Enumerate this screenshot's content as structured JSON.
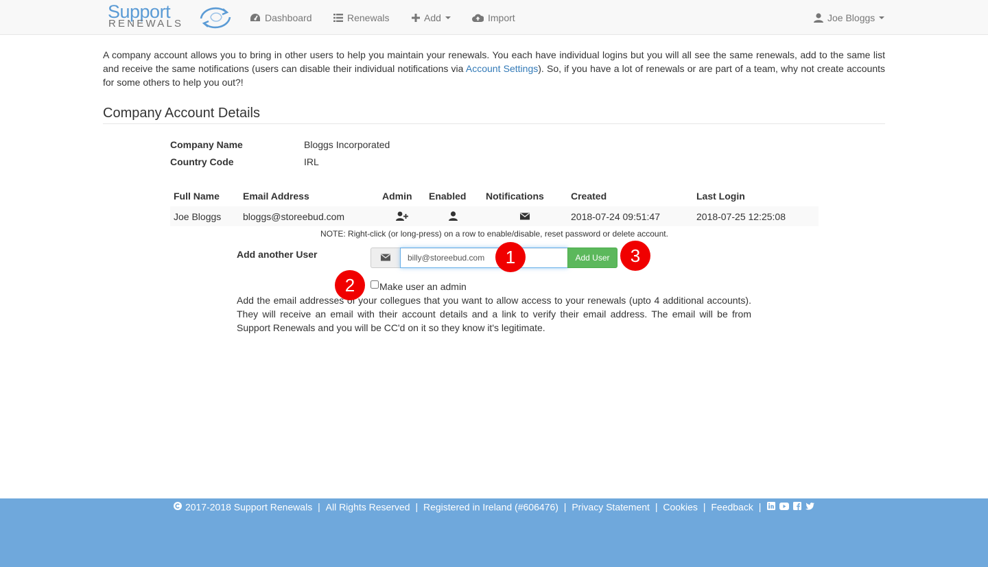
{
  "brand": {
    "line1": "Support",
    "line2": "RENEWALS"
  },
  "nav": {
    "dashboard": "Dashboard",
    "renewals": "Renewals",
    "add": "Add",
    "import": "Import",
    "user": "Joe Bloggs"
  },
  "intro": {
    "before": "A company account allows you to bring in other users to help you maintain your renewals. You each have individual logins but you will all see the same renewals, add to the same list and receive the same notifications (users can disable their individual notifications via ",
    "link": "Account Settings",
    "after": "). So, if you have a lot of renewals or are part of a team, why not create accounts for some others to help you out?!"
  },
  "section_title": "Company Account Details",
  "company": {
    "name_label": "Company Name",
    "name_value": "Bloggs Incorporated",
    "country_label": "Country Code",
    "country_value": "IRL"
  },
  "table": {
    "headers": {
      "full_name": "Full Name",
      "email": "Email Address",
      "admin": "Admin",
      "enabled": "Enabled",
      "notifications": "Notifications",
      "created": "Created",
      "last_login": "Last Login"
    },
    "rows": [
      {
        "full_name": "Joe Bloggs",
        "email": "bloggs@storeebud.com",
        "admin_icon": "user-plus-icon",
        "enabled_icon": "user-icon",
        "notifications_icon": "envelope-icon",
        "created": "2018-07-24 09:51:47",
        "last_login": "2018-07-25 12:25:08"
      }
    ],
    "note": "NOTE: Right-click (or long-press) on a row to enable/disable, reset password or delete account."
  },
  "add_user": {
    "label": "Add another User",
    "email_value": "billy@storeebud.com",
    "button": "Add User",
    "admin_checkbox_label": "Make user an admin",
    "admin_checked": false,
    "help": "Add the email addresses of your collegues that you want to allow access to your renewals (upto 4 additional accounts). They will receive an email with their account details and a link to verify their email address. The email will be from Support Renewals and you will be CC'd on it so they know it's legitimate."
  },
  "annotations": {
    "one": "1",
    "two": "2",
    "three": "3"
  },
  "footer": {
    "copyright": "2017-2018 Support Renewals",
    "rights": "All Rights Reserved",
    "registered": "Registered in Ireland (#606476)",
    "privacy": "Privacy Statement",
    "cookies": "Cookies",
    "feedback": "Feedback",
    "social_icons": [
      "linkedin-icon",
      "youtube-icon",
      "facebook-icon",
      "twitter-icon"
    ]
  },
  "colors": {
    "navbar_bg": "#f8f8f8",
    "link": "#337ab7",
    "success": "#5cb85c",
    "footer_bg": "#6fa8dc",
    "annotation": "#f00000",
    "logo_blue": "#5b9bd5"
  }
}
